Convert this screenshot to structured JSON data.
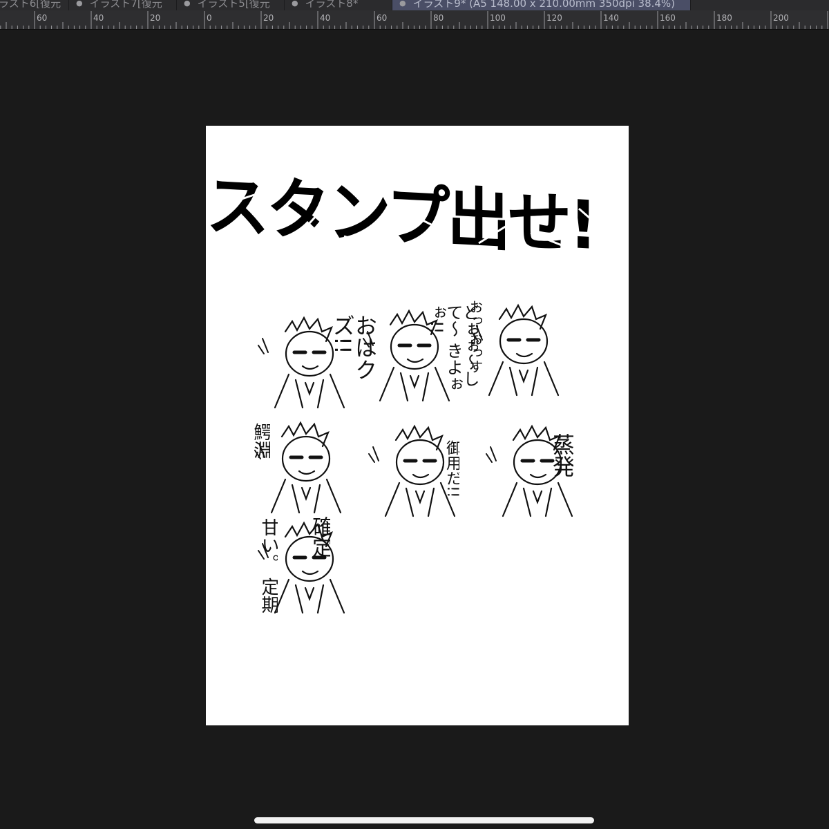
{
  "tabs": [
    {
      "label": "ラスト6[復元"
    },
    {
      "label": "イラスト7[復元"
    },
    {
      "label": "イラスト5[復元"
    },
    {
      "label": "イラスト8*"
    },
    {
      "label": "イラスト9* (A5 148.00 x 210.00mm 350dpi 38.4%)"
    }
  ],
  "active_tab": 4,
  "ruler": {
    "labels": [
      "60",
      "40",
      "20",
      "0",
      "20",
      "40",
      "60",
      "80",
      "100",
      "120",
      "140",
      "160",
      "180",
      "200"
    ]
  },
  "canvas": {
    "title": "スタンプ出せ!",
    "stamps": [
      {
        "text": "おはクズ!!"
      },
      {
        "text": "どぉぉ〜して〜 きよぉぉ!!"
      },
      {
        "text": "おっ おっす"
      },
      {
        "text": "鰐淵"
      },
      {
        "text": "御用だ!!"
      },
      {
        "text": "蒸発"
      },
      {
        "text": "確定"
      },
      {
        "text": "甘い。 定期"
      }
    ]
  },
  "colors": {
    "background": "#1a1a1a",
    "tabbar": "#2b2b2d",
    "active_tab": "#4a4e66",
    "ruler": "#2e2e30",
    "paper": "#ffffff"
  }
}
